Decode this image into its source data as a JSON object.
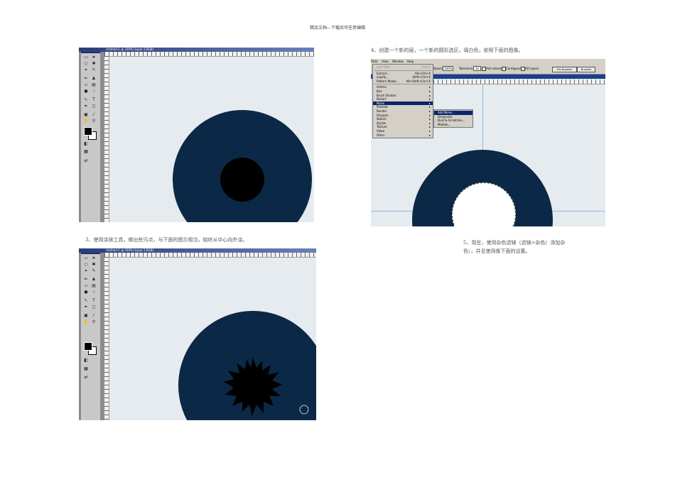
{
  "page": {
    "header": "精品文档---下载后可任意编辑",
    "caption_step3": "3、使用涂抹工具，做出些污点，与下面的图示相当，始终从中心向外涂。",
    "caption_step4": "4、创建一个新的层，一个新的圆形选区，填白色，依照下面的图像。",
    "caption_step5_line1": "5、现在，使用杂色滤镜（滤镜>杂色）添加杂",
    "caption_step5_line2": "色），并且使用像下面的设置。"
  },
  "colors": {
    "iris": "#0b2946",
    "pupil": "#000000",
    "canvas": "#e6ebef",
    "menu_highlight": "#0a246a"
  },
  "shot1": {
    "title_text": "Untitled-1 @ 100% (Layer 2,RGB)"
  },
  "shot2": {
    "title_text": "Untitled-1 @ 100% (Layer 2,RGB)",
    "brush_cursor_icon": "circle-cursor-icon"
  },
  "filter_shot": {
    "menubar": [
      "Filter",
      "View",
      "Window",
      "Help"
    ],
    "options": {
      "opacity_label": "Opacity:",
      "opacity_value": "100%",
      "tolerance_label": "Tolerance:",
      "tolerance_value": "32",
      "anti_aliased": "Anti-aliased",
      "contiguous": "Contiguous",
      "all_layers": "All Layers",
      "file_browser": "File Browser",
      "brushes": "Brushes"
    },
    "filter_menu": {
      "last_filter": {
        "label": "Last Filter",
        "shortcut": "Ctrl+F"
      },
      "extract": {
        "label": "Extract...",
        "shortcut": "Alt+Ctrl+X"
      },
      "liquify": {
        "label": "Liquify...",
        "shortcut": "Shift+Ctrl+X"
      },
      "pattern_maker": {
        "label": "Pattern Maker...",
        "shortcut": "Alt+Shift+Ctrl+X"
      },
      "groups": [
        "Artistic",
        "Blur",
        "Brush Strokes",
        "Distort",
        "Noise",
        "Pixelate",
        "Render",
        "Sharpen",
        "Sketch",
        "Stylize",
        "Texture",
        "Video",
        "Other"
      ]
    },
    "noise_submenu": [
      "Add Noise...",
      "Despeckle",
      "Dust & Scratches...",
      "Median..."
    ]
  }
}
